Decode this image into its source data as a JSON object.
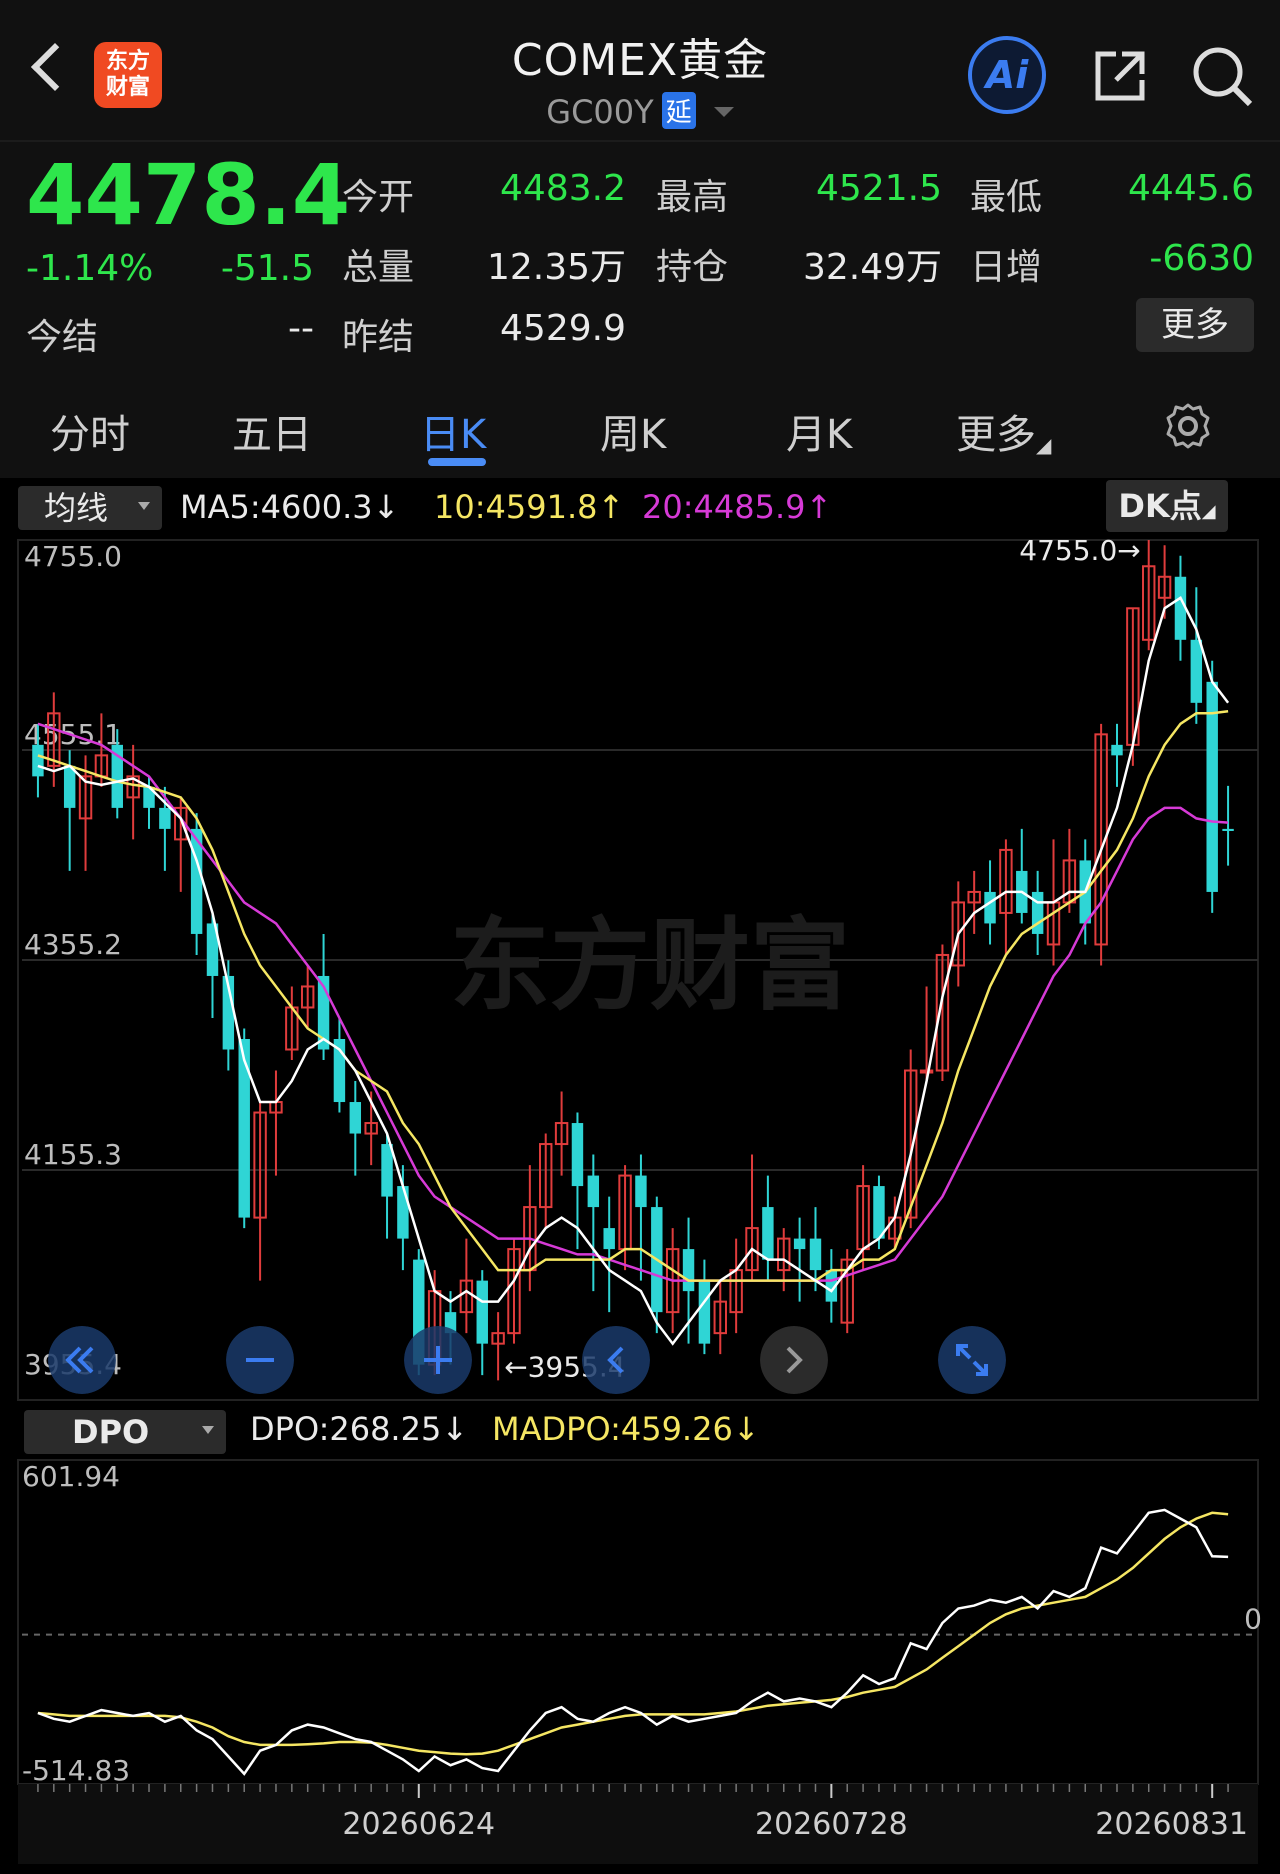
{
  "header": {
    "logo_line1": "东方",
    "logo_line2": "财富",
    "title": "COMEX黄金",
    "code": "GC00Y",
    "delay_badge": "延",
    "ai_label": "Ai"
  },
  "quote": {
    "price": "4478.4",
    "change_pct": "-1.14%",
    "change": "-51.5",
    "settle_label": "今结",
    "settle_value": "--",
    "open_label": "今开",
    "open_value": "4483.2",
    "high_label": "最高",
    "high_value": "4521.5",
    "low_label": "最低",
    "low_value": "4445.6",
    "volume_label": "总量",
    "volume_value": "12.35万",
    "oi_label": "持仓",
    "oi_value": "32.49万",
    "daily_inc_label": "日增",
    "daily_inc_value": "-6630",
    "prev_settle_label": "昨结",
    "prev_settle_value": "4529.9",
    "more_label": "更多"
  },
  "tabs": [
    {
      "label": "分时"
    },
    {
      "label": "五日"
    },
    {
      "label": "日K",
      "active": true
    },
    {
      "label": "周K"
    },
    {
      "label": "月K"
    },
    {
      "label": "更多"
    }
  ],
  "indicators": {
    "ma_select": "均线",
    "ma5": "MA5:4600.3↓",
    "ma10": "10:4591.8↑",
    "ma20": "20:4485.9↑",
    "dk_label": "DK点",
    "dpo_select": "DPO",
    "dpo": "DPO:268.25↓",
    "madpo": "MADPO:459.26↓"
  },
  "colors": {
    "up": "#e03c3c",
    "down": "#2fd5d5",
    "ma5": "#ffffff",
    "ma10": "#f5e663",
    "ma20": "#d63ad6",
    "price_green": "#2ee64c",
    "accent": "#4a8cf5"
  },
  "chart_data": {
    "type": "candlestick",
    "y_ticks": [
      "4755.0",
      "4555.1",
      "4355.2",
      "4155.3",
      "3955.4"
    ],
    "ylim": [
      3955.4,
      4755.0
    ],
    "high_marker": "4755.0",
    "low_marker": "3955.4",
    "x_ticks": [
      "20260624",
      "20260728",
      "20260831"
    ],
    "candles": [
      [
        4560,
        4530,
        4580,
        4510
      ],
      [
        4540,
        4590,
        4610,
        4520
      ],
      [
        4540,
        4500,
        4555,
        4440
      ],
      [
        4490,
        4530,
        4550,
        4440
      ],
      [
        4530,
        4550,
        4590,
        4520
      ],
      [
        4560,
        4500,
        4575,
        4490
      ],
      [
        4510,
        4530,
        4560,
        4470
      ],
      [
        4520,
        4500,
        4530,
        4480
      ],
      [
        4500,
        4480,
        4520,
        4440
      ],
      [
        4470,
        4500,
        4510,
        4420
      ],
      [
        4480,
        4380,
        4495,
        4360
      ],
      [
        4390,
        4340,
        4400,
        4300
      ],
      [
        4340,
        4270,
        4355,
        4250
      ],
      [
        4280,
        4110,
        4290,
        4100
      ],
      [
        4110,
        4210,
        4220,
        4050
      ],
      [
        4210,
        4220,
        4250,
        4150
      ],
      [
        4270,
        4310,
        4330,
        4260
      ],
      [
        4310,
        4330,
        4350,
        4290
      ],
      [
        4340,
        4270,
        4380,
        4260
      ],
      [
        4280,
        4220,
        4300,
        4210
      ],
      [
        4220,
        4190,
        4240,
        4150
      ],
      [
        4190,
        4200,
        4230,
        4160
      ],
      [
        4180,
        4130,
        4190,
        4090
      ],
      [
        4140,
        4090,
        4160,
        4060
      ],
      [
        4070,
        3970,
        4080,
        3960
      ],
      [
        3970,
        4040,
        4060,
        3960
      ],
      [
        4020,
        4000,
        4040,
        3970
      ],
      [
        4020,
        4050,
        4090,
        4000
      ],
      [
        4050,
        3990,
        4060,
        3960
      ],
      [
        3990,
        4000,
        4020,
        3955
      ],
      [
        4000,
        4080,
        4090,
        3990
      ],
      [
        4060,
        4120,
        4160,
        4040
      ],
      [
        4120,
        4180,
        4190,
        4100
      ],
      [
        4180,
        4200,
        4230,
        4150
      ],
      [
        4200,
        4140,
        4210,
        4080
      ],
      [
        4150,
        4120,
        4170,
        4040
      ],
      [
        4100,
        4080,
        4130,
        4020
      ],
      [
        4080,
        4150,
        4160,
        4060
      ],
      [
        4150,
        4120,
        4170,
        4050
      ],
      [
        4120,
        4020,
        4130,
        4000
      ],
      [
        4020,
        4080,
        4100,
        4000
      ],
      [
        4080,
        4040,
        4110,
        3990
      ],
      [
        4050,
        3990,
        4070,
        3980
      ],
      [
        4000,
        4030,
        4050,
        3980
      ],
      [
        4020,
        4060,
        4090,
        4000
      ],
      [
        4060,
        4100,
        4170,
        4050
      ],
      [
        4120,
        4070,
        4150,
        4050
      ],
      [
        4060,
        4090,
        4100,
        4040
      ],
      [
        4090,
        4080,
        4110,
        4030
      ],
      [
        4090,
        4060,
        4120,
        4040
      ],
      [
        4060,
        4030,
        4080,
        4010
      ],
      [
        4010,
        4070,
        4080,
        4000
      ],
      [
        4080,
        4140,
        4160,
        4060
      ],
      [
        4140,
        4090,
        4150,
        4080
      ],
      [
        4090,
        4110,
        4130,
        4080
      ],
      [
        4110,
        4250,
        4270,
        4100
      ],
      [
        4250,
        4250,
        4330,
        4240
      ],
      [
        4250,
        4360,
        4370,
        4240
      ],
      [
        4350,
        4410,
        4430,
        4330
      ],
      [
        4410,
        4420,
        4440,
        4380
      ],
      [
        4420,
        4390,
        4450,
        4370
      ],
      [
        4400,
        4460,
        4470,
        4360
      ],
      [
        4440,
        4400,
        4480,
        4390
      ],
      [
        4420,
        4380,
        4440,
        4360
      ],
      [
        4370,
        4410,
        4470,
        4350
      ],
      [
        4410,
        4450,
        4480,
        4400
      ],
      [
        4450,
        4390,
        4470,
        4370
      ],
      [
        4370,
        4570,
        4580,
        4350
      ],
      [
        4560,
        4550,
        4580,
        4520
      ],
      [
        4560,
        4690,
        4690,
        4540
      ],
      [
        4660,
        4730,
        4755,
        4650
      ],
      [
        4700,
        4720,
        4750,
        4680
      ],
      [
        4720,
        4660,
        4740,
        4640
      ],
      [
        4660,
        4600,
        4710,
        4580
      ],
      [
        4620,
        4420,
        4640,
        4400
      ],
      [
        4480,
        4478,
        4521,
        4445
      ]
    ],
    "ma5": [
      4540,
      4535,
      4540,
      4525,
      4522,
      4525,
      4528,
      4520,
      4505,
      4490,
      4450,
      4400,
      4330,
      4260,
      4220,
      4220,
      4240,
      4270,
      4280,
      4270,
      4250,
      4220,
      4190,
      4140,
      4090,
      4040,
      4030,
      4040,
      4030,
      4030,
      4050,
      4080,
      4100,
      4110,
      4100,
      4080,
      4060,
      4050,
      4040,
      4010,
      3990,
      4010,
      4030,
      4050,
      4060,
      4080,
      4070,
      4070,
      4060,
      4050,
      4040,
      4060,
      4080,
      4090,
      4110,
      4170,
      4240,
      4320,
      4380,
      4400,
      4410,
      4420,
      4420,
      4410,
      4410,
      4420,
      4420,
      4460,
      4500,
      4560,
      4640,
      4690,
      4700,
      4670,
      4620,
      4600
    ],
    "ma10": [
      4550,
      4545,
      4540,
      4535,
      4530,
      4525,
      4522,
      4520,
      4515,
      4510,
      4490,
      4460,
      4420,
      4380,
      4350,
      4330,
      4310,
      4290,
      4280,
      4270,
      4250,
      4240,
      4230,
      4200,
      4180,
      4150,
      4120,
      4100,
      4080,
      4060,
      4060,
      4060,
      4070,
      4070,
      4070,
      4070,
      4070,
      4080,
      4080,
      4070,
      4060,
      4050,
      4050,
      4050,
      4050,
      4050,
      4050,
      4050,
      4050,
      4050,
      4060,
      4060,
      4070,
      4070,
      4080,
      4120,
      4160,
      4200,
      4250,
      4290,
      4330,
      4360,
      4380,
      4390,
      4400,
      4410,
      4420,
      4440,
      4460,
      4490,
      4530,
      4560,
      4580,
      4590,
      4590,
      4592
    ],
    "ma20": [
      4580,
      4575,
      4570,
      4565,
      4560,
      4550,
      4540,
      4530,
      4510,
      4490,
      4470,
      4450,
      4430,
      4410,
      4400,
      4390,
      4370,
      4350,
      4330,
      4300,
      4270,
      4240,
      4210,
      4180,
      4150,
      4130,
      4120,
      4110,
      4100,
      4090,
      4090,
      4090,
      4085,
      4080,
      4075,
      4075,
      4070,
      4065,
      4060,
      4055,
      4050,
      4050,
      4050,
      4050,
      4050,
      4050,
      4050,
      4050,
      4050,
      4050,
      4050,
      4055,
      4060,
      4065,
      4070,
      4090,
      4110,
      4130,
      4160,
      4190,
      4220,
      4250,
      4280,
      4310,
      4340,
      4360,
      4390,
      4410,
      4440,
      4470,
      4490,
      4500,
      4500,
      4490,
      4487,
      4486
    ],
    "dpo_ticks": [
      "601.94",
      "0",
      "-514.83"
    ],
    "dpo_ylim": [
      -514.83,
      601.94
    ],
    "dpo": [
      -270,
      -290,
      -300,
      -280,
      -260,
      -270,
      -280,
      -270,
      -300,
      -280,
      -330,
      -360,
      -420,
      -480,
      -400,
      -380,
      -330,
      -310,
      -320,
      -340,
      -360,
      -370,
      -400,
      -430,
      -470,
      -420,
      -450,
      -430,
      -460,
      -470,
      -400,
      -330,
      -270,
      -250,
      -290,
      -300,
      -270,
      -250,
      -270,
      -310,
      -280,
      -300,
      -290,
      -280,
      -270,
      -230,
      -200,
      -230,
      -220,
      -230,
      -250,
      -200,
      -140,
      -170,
      -150,
      -30,
      -50,
      40,
      90,
      100,
      120,
      110,
      130,
      90,
      150,
      130,
      160,
      300,
      280,
      350,
      420,
      430,
      400,
      370,
      270,
      268
    ],
    "madpo": [
      -270,
      -275,
      -280,
      -280,
      -280,
      -280,
      -280,
      -280,
      -280,
      -285,
      -300,
      -320,
      -350,
      -370,
      -380,
      -380,
      -380,
      -378,
      -375,
      -370,
      -370,
      -372,
      -380,
      -390,
      -400,
      -405,
      -410,
      -412,
      -410,
      -400,
      -380,
      -360,
      -340,
      -320,
      -310,
      -300,
      -290,
      -280,
      -275,
      -275,
      -275,
      -275,
      -275,
      -270,
      -265,
      -255,
      -245,
      -240,
      -235,
      -230,
      -225,
      -215,
      -200,
      -190,
      -180,
      -150,
      -120,
      -80,
      -40,
      0,
      40,
      70,
      90,
      100,
      110,
      120,
      130,
      160,
      190,
      230,
      280,
      330,
      370,
      400,
      420,
      415
    ]
  }
}
